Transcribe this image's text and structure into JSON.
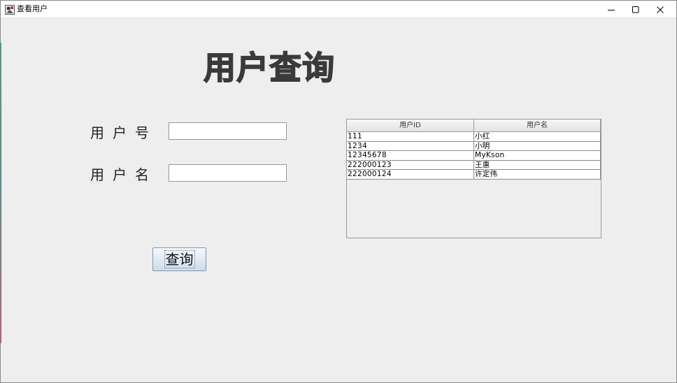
{
  "window": {
    "title": "查看用户",
    "icon": "java-app-icon"
  },
  "controls": {
    "minimize_icon": "minimize-icon",
    "maximize_icon": "maximize-icon",
    "close_icon": "close-icon"
  },
  "form": {
    "heading": "用户查询",
    "user_id_label": "用户号",
    "user_id_value": "",
    "user_name_label": "用户名",
    "user_name_value": "",
    "query_button": "查询"
  },
  "table": {
    "columns": [
      "用户ID",
      "用户名"
    ],
    "rows": [
      [
        "111",
        "小红"
      ],
      [
        "1234",
        "小明"
      ],
      [
        "12345678",
        "MyKson"
      ],
      [
        "222000123",
        "王惠"
      ],
      [
        "222000124",
        "许定伟"
      ]
    ]
  }
}
